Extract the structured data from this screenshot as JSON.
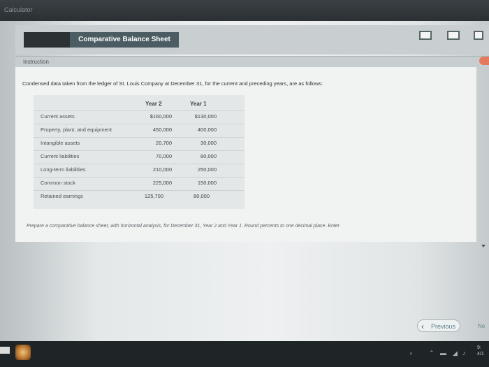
{
  "app": {
    "top_label": "Calculator"
  },
  "header": {
    "title": "Comparative Balance Sheet"
  },
  "instruction": {
    "label": "Instruction",
    "prompt": "Condensed data taken from the ledger of St. Louis Company at December 31, for the current and preceding years, are as follows:"
  },
  "table": {
    "columns": [
      "Year 2",
      "Year 1"
    ],
    "rows": [
      {
        "label": "Current assets",
        "year2": "$160,000",
        "year1": "$130,000"
      },
      {
        "label": "Property, plant, and equipment",
        "year2": "450,000",
        "year1": "400,000"
      },
      {
        "label": "Intangible assets",
        "year2": "20,700",
        "year1": "30,000"
      },
      {
        "label": "Current liabilities",
        "year2": "70,000",
        "year1": "80,000"
      },
      {
        "label": "Long-term liabilities",
        "year2": "210,000",
        "year1": "250,000"
      },
      {
        "label": "Common stock",
        "year2": "225,000",
        "year1": "150,000"
      },
      {
        "label": "Retained earnings",
        "year2": "125,700",
        "year1": "80,000"
      }
    ]
  },
  "question": "Prepare a comparative balance sheet, with horizontal analysis, for December 31, Year 2 and Year 1. Round percents to one decimal place. Enter",
  "nav": {
    "previous_label": "Previous",
    "next_label": "Ne"
  },
  "clock": {
    "time": "9:",
    "date": "4/1"
  },
  "colors": {
    "title_tab": "#4b5c62",
    "accent_orange": "#e37a5b",
    "link_blue": "#5e7f8b"
  }
}
